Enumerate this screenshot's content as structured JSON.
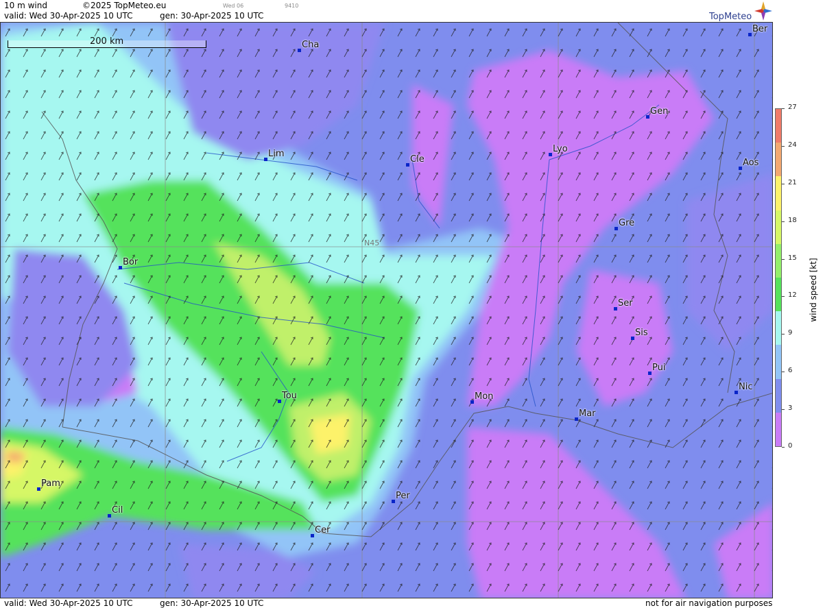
{
  "header": {
    "product": "10 m wind",
    "copyright": "©2025 TopMeteo.eu",
    "valid": "valid:  Wed  30-Apr-2025  10 UTC",
    "generated": "gen: 30-Apr-2025 10 UTC",
    "day_tab": "Wed 06",
    "code": "9410"
  },
  "brand": {
    "name": "TopMeteo"
  },
  "map": {
    "scale_label": "200 km",
    "parallel_label": "N45",
    "cities": [
      {
        "name": "Cha"
      },
      {
        "name": "Ber"
      },
      {
        "name": "Gen"
      },
      {
        "name": "Lim"
      },
      {
        "name": "Cle"
      },
      {
        "name": "Lyo"
      },
      {
        "name": "Aos"
      },
      {
        "name": "Gre"
      },
      {
        "name": "Bor"
      },
      {
        "name": "Ser"
      },
      {
        "name": "Sis"
      },
      {
        "name": "Pui"
      },
      {
        "name": "Tou"
      },
      {
        "name": "Mon"
      },
      {
        "name": "Nic"
      },
      {
        "name": "Mar"
      },
      {
        "name": "Pam"
      },
      {
        "name": "Cil"
      },
      {
        "name": "Per"
      },
      {
        "name": "Cer"
      }
    ]
  },
  "legend": {
    "title": "wind speed [kt]",
    "ticks": [
      "27",
      "24",
      "21",
      "18",
      "15",
      "12",
      "9",
      "6",
      "3",
      "0"
    ],
    "colors": [
      "#f07b69",
      "#f3a870",
      "#fdf26a",
      "#d6f766",
      "#93ef6a",
      "#55e25b",
      "#a6f7f0",
      "#92c4f7",
      "#7f8dee",
      "#c97cf7"
    ]
  },
  "footer": {
    "valid": "valid:  Wed  30-Apr-2025  10 UTC",
    "generated": "gen: 30-Apr-2025 10 UTC",
    "disclaimer": "not for air navigation purposes"
  }
}
